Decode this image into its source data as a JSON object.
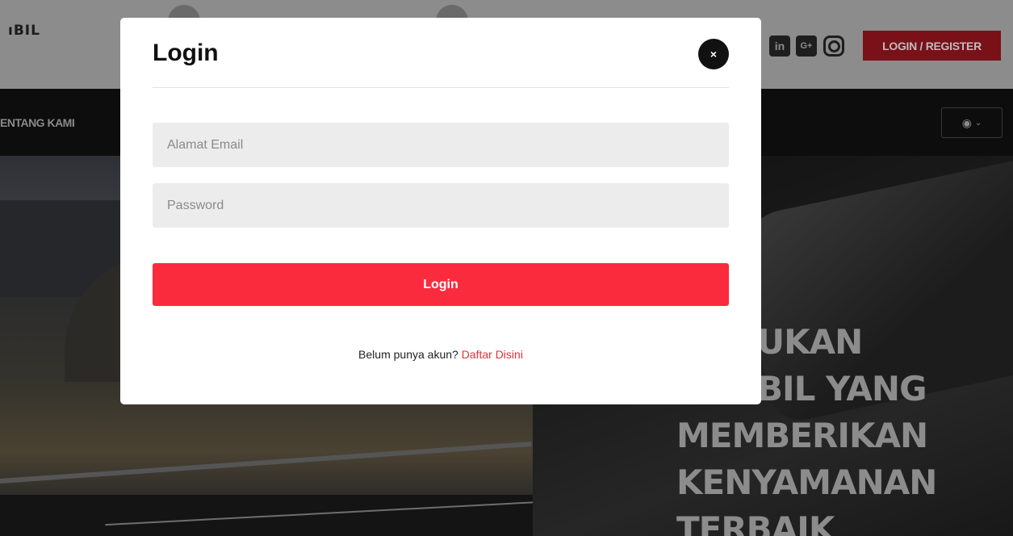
{
  "header": {
    "logo_fragment": "ıBIL",
    "cta_label": "LOGIN / REGISTER",
    "social_icons": [
      "linkedin-icon",
      "google-plus-icon",
      "instagram-icon"
    ]
  },
  "nav": {
    "item_about": "ENTANG KAMI",
    "user_icon": "user-circle-icon",
    "chevron_icon": "chevron-down-icon"
  },
  "hero": {
    "title_lines": [
      "UKAN",
      "BIL YANG",
      "MEMBERIKAN",
      "KENYAMANAN",
      "TERBAIK"
    ]
  },
  "modal": {
    "title": "Login",
    "close_glyph": "×",
    "email_placeholder": "Alamat Email",
    "password_placeholder": "Password",
    "submit_label": "Login",
    "signup_prompt": "Belum punya akun? ",
    "signup_link": "Daftar Disini"
  },
  "colors": {
    "primary_button": "#fb2b3e",
    "link": "#f22a3c",
    "header_cta": "#7a1018"
  }
}
